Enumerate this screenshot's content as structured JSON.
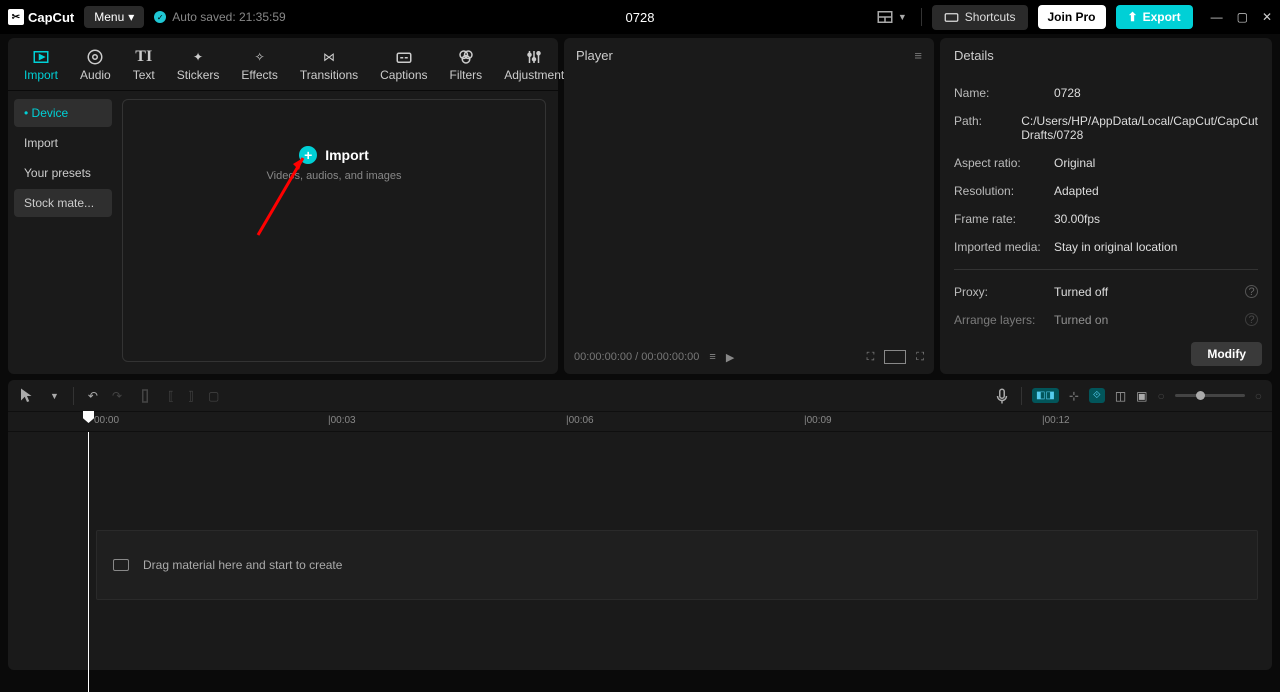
{
  "app": {
    "name": "CapCut"
  },
  "topbar": {
    "menu": "Menu",
    "autosave": "Auto saved: 21:35:59",
    "project_title": "0728",
    "shortcuts": "Shortcuts",
    "join_pro": "Join Pro",
    "export": "Export"
  },
  "tabs": [
    {
      "label": "Import",
      "active": true
    },
    {
      "label": "Audio"
    },
    {
      "label": "Text"
    },
    {
      "label": "Stickers"
    },
    {
      "label": "Effects"
    },
    {
      "label": "Transitions"
    },
    {
      "label": "Captions"
    },
    {
      "label": "Filters"
    },
    {
      "label": "Adjustment"
    }
  ],
  "sidebar": {
    "items": [
      {
        "label": "Device",
        "active": true
      },
      {
        "label": "Import"
      },
      {
        "label": "Your presets"
      },
      {
        "label": "Stock mate..."
      }
    ]
  },
  "import_area": {
    "button": "Import",
    "subtitle": "Videos, audios, and images"
  },
  "player": {
    "title": "Player",
    "time_current": "00:00:00:00",
    "time_total": "00:00:00:00"
  },
  "details": {
    "title": "Details",
    "rows": [
      {
        "label": "Name:",
        "value": "0728"
      },
      {
        "label": "Path:",
        "value": "C:/Users/HP/AppData/Local/CapCut/CapCut Drafts/0728"
      },
      {
        "label": "Aspect ratio:",
        "value": "Original"
      },
      {
        "label": "Resolution:",
        "value": "Adapted"
      },
      {
        "label": "Frame rate:",
        "value": "30.00fps"
      },
      {
        "label": "Imported media:",
        "value": "Stay in original location"
      }
    ],
    "rows2": [
      {
        "label": "Proxy:",
        "value": "Turned off"
      },
      {
        "label": "Arrange layers:",
        "value": "Turned on"
      }
    ],
    "modify": "Modify"
  },
  "timeline": {
    "ticks": [
      "00:00",
      "|00:03",
      "|00:06",
      "|00:09",
      "|00:12"
    ],
    "placeholder": "Drag material here and start to create"
  }
}
